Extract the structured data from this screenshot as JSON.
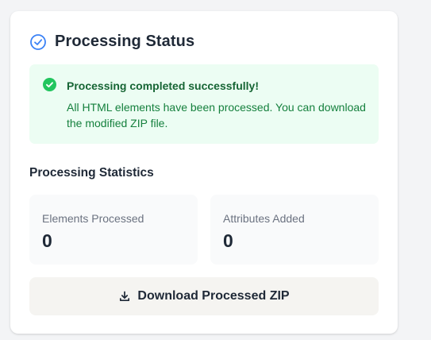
{
  "card": {
    "title": "Processing Status",
    "title_icon": "check-circle-outline-icon"
  },
  "alert": {
    "icon": "check-circle-filled-icon",
    "title": "Processing completed successfully!",
    "message": "All HTML elements have been processed. You can download the modified ZIP file."
  },
  "statistics": {
    "heading": "Processing Statistics",
    "items": [
      {
        "label": "Elements Processed",
        "value": "0"
      },
      {
        "label": "Attributes Added",
        "value": "0"
      }
    ]
  },
  "download": {
    "label": "Download Processed ZIP",
    "icon": "download-icon"
  },
  "colors": {
    "accent": "#3b82f6",
    "success": "#22c55e",
    "success_bg": "#ecfdf3",
    "success_text": "#166534"
  }
}
